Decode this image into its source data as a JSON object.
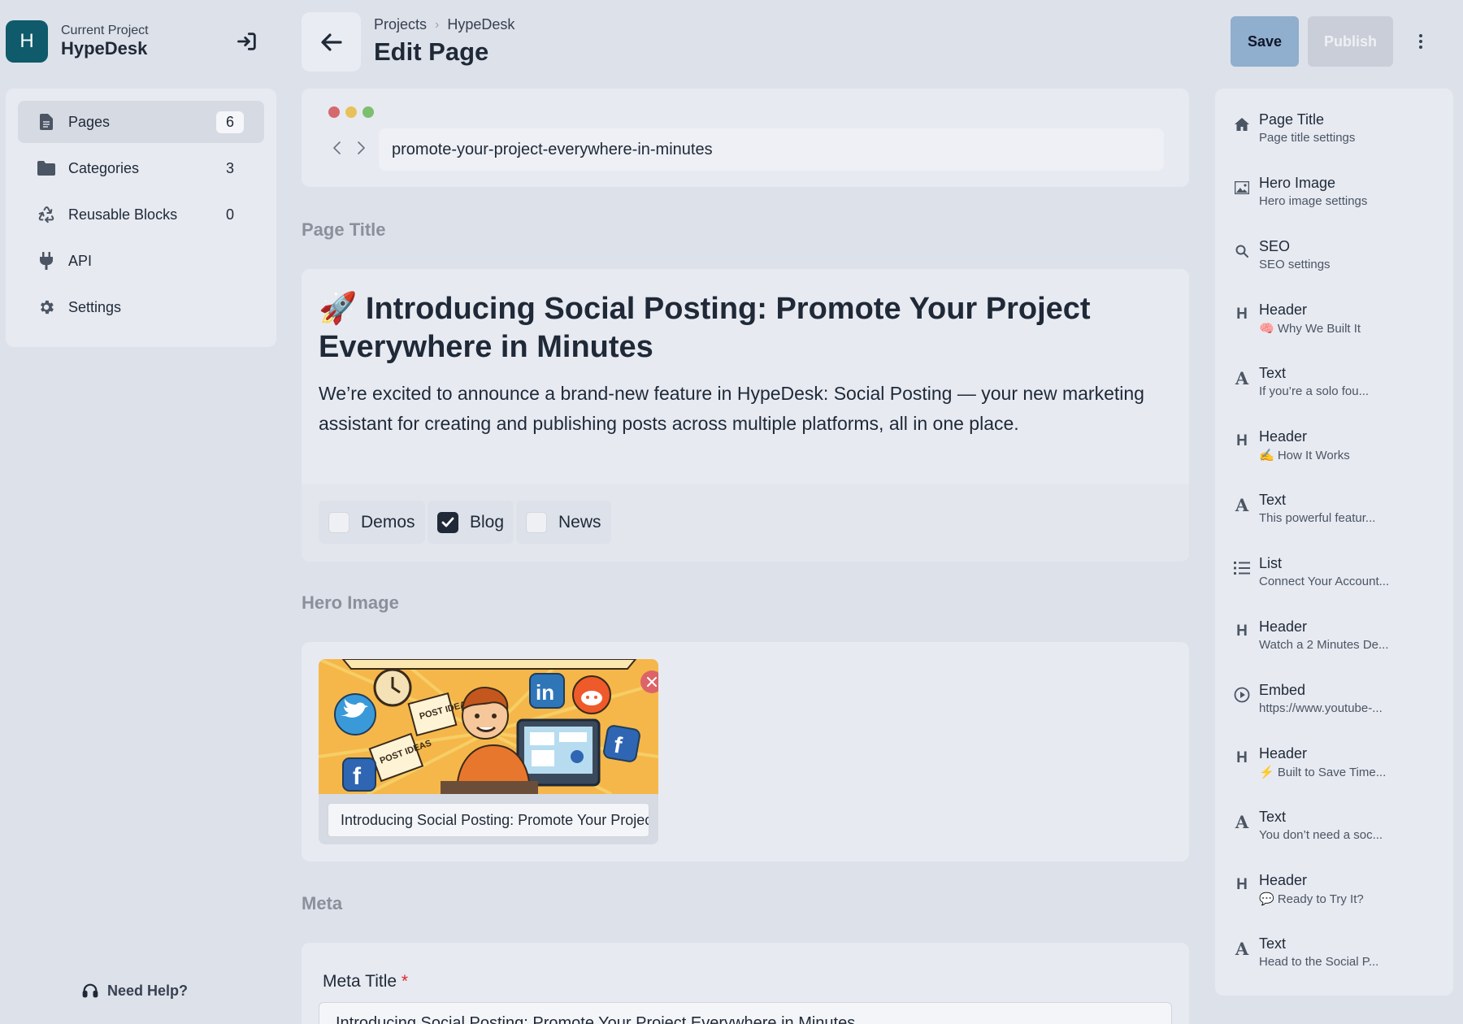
{
  "project": {
    "initial": "H",
    "label": "Current Project",
    "name": "HypeDesk"
  },
  "nav": {
    "items": [
      {
        "label": "Pages",
        "count": "6",
        "icon": "file-icon",
        "active": true
      },
      {
        "label": "Categories",
        "count": "3",
        "icon": "folder-icon",
        "active": false
      },
      {
        "label": "Reusable Blocks",
        "count": "0",
        "icon": "recycle-icon",
        "active": false
      },
      {
        "label": "API",
        "icon": "plug-icon",
        "active": false
      },
      {
        "label": "Settings",
        "icon": "gear-icon",
        "active": false
      }
    ],
    "help_label": "Need Help?"
  },
  "header": {
    "breadcrumb": [
      "Projects",
      "HypeDesk"
    ],
    "title": "Edit Page",
    "save_label": "Save",
    "publish_label": "Publish"
  },
  "url": {
    "slug": "promote-your-project-everywhere-in-minutes",
    "dot_colors": [
      "#d46a6e",
      "#e8c15a",
      "#7cbf6e"
    ]
  },
  "sections": {
    "page_title": "Page Title",
    "hero_image": "Hero Image",
    "meta": "Meta"
  },
  "page_title": {
    "emoji": "🚀",
    "headline": "Introducing Social Posting: Promote Your Project Everywhere in Minutes",
    "lead": "We’re excited to announce a brand-new feature in HypeDesk: Social Posting — your new marketing assistant for creating and publishing posts across multiple platforms, all in one place.",
    "tags": [
      {
        "label": "Demos",
        "checked": false
      },
      {
        "label": "Blog",
        "checked": true
      },
      {
        "label": "News",
        "checked": false
      }
    ]
  },
  "hero": {
    "alt_text": "Introducing Social Posting: Promote Your Project Everywhere in Minutes",
    "image_texts": [
      "POST IDEAS",
      "POST IDEAS",
      "in",
      "f",
      "f"
    ]
  },
  "meta": {
    "title_label": "Meta Title",
    "required_mark": "*",
    "title_value": "Introducing Social Posting: Promote Your Project Everywhere in Minutes"
  },
  "outline": {
    "items": [
      {
        "icon": "home-icon",
        "title": "Page Title",
        "sub": "Page title settings"
      },
      {
        "icon": "image-icon",
        "title": "Hero Image",
        "sub": "Hero image settings"
      },
      {
        "icon": "search-icon",
        "title": "SEO",
        "sub": "SEO settings"
      },
      {
        "icon": "heading-icon",
        "title": "Header",
        "sub": "🧠 Why We Built It"
      },
      {
        "icon": "text-icon",
        "title": "Text",
        "sub": "If you’re a solo fou..."
      },
      {
        "icon": "heading-icon",
        "title": "Header",
        "sub": "✍️ How It Works"
      },
      {
        "icon": "text-icon",
        "title": "Text",
        "sub": "This powerful featur..."
      },
      {
        "icon": "list-icon",
        "title": "List",
        "sub": "Connect Your Account..."
      },
      {
        "icon": "heading-icon",
        "title": "Header",
        "sub": "Watch a 2 Minutes De..."
      },
      {
        "icon": "play-icon",
        "title": "Embed",
        "sub": "https://www.youtube-..."
      },
      {
        "icon": "heading-icon",
        "title": "Header",
        "sub": "⚡ Built to Save Time..."
      },
      {
        "icon": "text-icon",
        "title": "Text",
        "sub": "You don’t need a soc..."
      },
      {
        "icon": "heading-icon",
        "title": "Header",
        "sub": "💬 Ready to Try It?"
      },
      {
        "icon": "text-icon",
        "title": "Text",
        "sub": "Head to the Social P..."
      }
    ]
  },
  "colors": {
    "accent": "#90aecd",
    "avatar": "#0f5a6b",
    "remove": "#dc6468"
  }
}
